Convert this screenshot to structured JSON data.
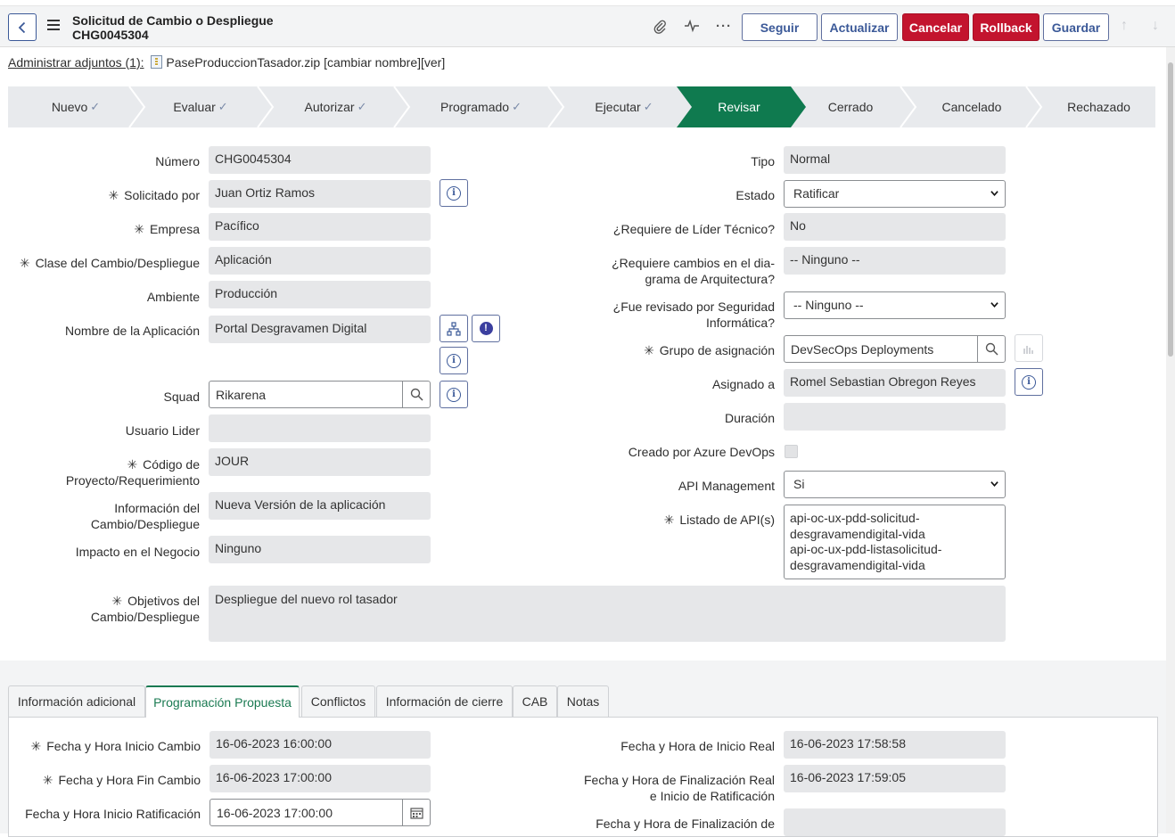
{
  "header": {
    "title": "Solicitud de Cambio o Despliegue",
    "number": "CHG0045304",
    "buttons": {
      "follow": "Seguir",
      "update": "Actualizar",
      "cancel": "Cancelar",
      "rollback": "Rollback",
      "save": "Guardar"
    }
  },
  "attachments": {
    "manage_label": "Administrar adjuntos (1):",
    "filename": "PaseProduccionTasador.zip",
    "actions": "[cambiar nombre][ver]"
  },
  "stages": [
    {
      "label": "Nuevo",
      "done": true
    },
    {
      "label": "Evaluar",
      "done": true
    },
    {
      "label": "Autorizar",
      "done": true
    },
    {
      "label": "Programado",
      "done": true
    },
    {
      "label": "Ejecutar",
      "done": true
    },
    {
      "label": "Revisar",
      "active": true
    },
    {
      "label": "Cerrado"
    },
    {
      "label": "Cancelado"
    },
    {
      "label": "Rechazado"
    }
  ],
  "colors": {
    "active_stage": "#0f7a4f",
    "red_button": "#c3142e",
    "accent_blue": "#3b5998"
  },
  "form": {
    "left": {
      "numero": {
        "label": "Número",
        "value": "CHG0045304"
      },
      "solicitado_por": {
        "label": "Solicitado por",
        "value": "Juan Ortiz Ramos"
      },
      "empresa": {
        "label": "Empresa",
        "value": "Pacífico"
      },
      "clase": {
        "label": "Clase del Cambio/Despliegue",
        "value": "Aplicación"
      },
      "ambiente": {
        "label": "Ambiente",
        "value": "Producción"
      },
      "aplicacion": {
        "label": "Nombre de la Aplicación",
        "value": "Portal Desgravamen Digital"
      },
      "squad": {
        "label": "Squad",
        "value": "Rikarena"
      },
      "usuario_lider": {
        "label": "Usuario Lider",
        "value": ""
      },
      "codigo_proyecto": {
        "label1": "Código de",
        "label2": "Proyecto/Requerimiento",
        "value": "JOUR"
      },
      "informacion": {
        "label1": "Información del",
        "label2": "Cambio/Despliegue",
        "value": "Nueva Versión de la aplicación"
      },
      "impacto": {
        "label": "Impacto en el Negocio",
        "value": "Ninguno"
      },
      "objetivos": {
        "label1": "Objetivos del",
        "label2": "Cambio/Despliegue",
        "value": "Despliegue del nuevo rol tasador"
      }
    },
    "right": {
      "tipo": {
        "label": "Tipo",
        "value": "Normal"
      },
      "estado": {
        "label": "Estado",
        "value": "Ratificar"
      },
      "lider_tecnico": {
        "label": "¿Requiere de Líder Técnico?",
        "value": "No"
      },
      "arquitectura": {
        "label1": "¿Requiere cambios en el dia-",
        "label2": "grama de Arquitectura?",
        "value": "-- Ninguno --"
      },
      "seguridad": {
        "label1": "¿Fue revisado por Seguridad",
        "label2": "Informática?",
        "value": "-- Ninguno --"
      },
      "grupo": {
        "label": "Grupo de asignación",
        "value": "DevSecOps Deployments"
      },
      "asignado": {
        "label": "Asignado a",
        "value": "Romel Sebastian Obregon Reyes"
      },
      "duracion": {
        "label": "Duración",
        "value": ""
      },
      "azure": {
        "label": "Creado por Azure DevOps"
      },
      "api_mgmt": {
        "label": "API Management",
        "value": "Si"
      },
      "apis": {
        "label": "Listado de API(s)",
        "lines": [
          "api-oc-ux-pdd-solicitud-",
          "desgravamendigital-vida",
          "api-oc-ux-pdd-listasolicitud-",
          "desgravamendigital-vida"
        ]
      }
    }
  },
  "tabs": [
    {
      "label": "Información adicional"
    },
    {
      "label": "Programación Propuesta",
      "active": true
    },
    {
      "label": "Conflictos"
    },
    {
      "label": "Información de cierre"
    },
    {
      "label": "CAB"
    },
    {
      "label": "Notas"
    }
  ],
  "schedule": {
    "inicio_cambio": {
      "label": "Fecha y Hora Inicio Cambio",
      "value": "16-06-2023 16:00:00"
    },
    "fin_cambio": {
      "label": "Fecha y Hora Fin Cambio",
      "value": "16-06-2023 17:00:00"
    },
    "inicio_ratificacion": {
      "label": "Fecha y Hora Inicio Ratificación",
      "value": "16-06-2023 17:00:00"
    },
    "inicio_real": {
      "label": "Fecha y Hora de Inicio Real",
      "value": "16-06-2023 17:58:58"
    },
    "fin_real": {
      "label1": "Fecha y Hora de Finalización Real",
      "label2": "e Inicio de Ratificación",
      "value": "16-06-2023 17:59:05"
    },
    "fin_de": {
      "label": "Fecha y Hora de Finalización de",
      "value": ""
    }
  }
}
